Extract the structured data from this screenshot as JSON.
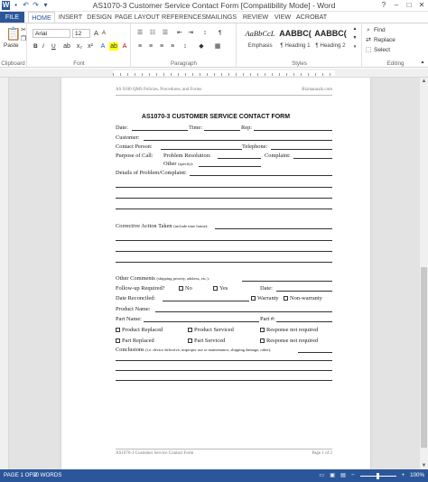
{
  "window": {
    "title": "AS1070-3 Customer Service Contact Form [Compatibility Mode] - Word",
    "controls": {
      "help": "?",
      "minimize": "–",
      "restore": "□",
      "close": "✕"
    }
  },
  "tabs": {
    "file": "FILE",
    "home": "HOME",
    "insert": "INSERT",
    "design": "DESIGN",
    "page_layout": "PAGE LAYOUT",
    "references": "REFERENCES",
    "mailings": "MAILINGS",
    "review": "REVIEW",
    "view": "VIEW",
    "acrobat": "ACROBAT"
  },
  "ribbon": {
    "clipboard": {
      "label": "Clipboard",
      "paste": "Paste"
    },
    "font": {
      "label": "Font",
      "name": "Arial",
      "size": "12",
      "bold": "B",
      "italic": "I",
      "underline": "U",
      "grow": "A",
      "shrink": "A"
    },
    "paragraph": {
      "label": "Paragraph",
      "marks": "¶"
    },
    "styles": {
      "label": "Styles",
      "items": [
        {
          "sample": "AaBbCcL",
          "name": "Emphasis"
        },
        {
          "sample": "AABBC(",
          "name": "¶ Heading 1"
        },
        {
          "sample": "AABBC(",
          "name": "¶ Heading 2"
        }
      ]
    },
    "editing": {
      "label": "Editing",
      "find": "Find",
      "replace": "Replace",
      "select": "Select"
    }
  },
  "document": {
    "header_left": "AS 9100 QMS Policies, Procedures, and Forms",
    "header_right": "Bizmanualz.com",
    "form_title": "AS1070-3 CUSTOMER SERVICE CONTACT FORM",
    "date": "Date:",
    "time": "Time:",
    "rep": "Rep:",
    "customer": "Customer:",
    "contact_person": "Contact Person:",
    "telephone": "Telephone:",
    "purpose": "Purpose of Call:",
    "problem_resolution": "Problem Resolution:",
    "complaint": "Complaint:",
    "other": "Other",
    "specify": "(specify):",
    "details": "Details of Problem/Complaint:",
    "corrective": "Corrective Action Taken",
    "corrective_note": "(include time frame):",
    "other_comments": "Other Comments",
    "other_comments_note": "(shipping priority, address, etc.):",
    "followup": "Follow-up Required?",
    "no": "No",
    "yes": "Yes",
    "date2": "Date:",
    "date_reconciled": "Date Reconciled:",
    "warranty": "Warranty",
    "non_warranty": "Non-warranty",
    "product_name": "Product Name:",
    "part_name": "Part Name:",
    "part_no": "Part #:",
    "product_replaced": "Product Replaced",
    "product_serviced": "Product Serviced",
    "response_not_required_1": "Response not required",
    "part_replaced": "Part Replaced",
    "part_serviced": "Part Serviced",
    "response_not_required_2": "Response not required",
    "conclusions": "Conclusions",
    "conclusions_note": "(i.e. device defective, improper use or maintenance, shipping damage, other):",
    "footer_left": "AS1070-3 Customer Service Contact Form",
    "footer_right": "Page 1 of 2"
  },
  "status": {
    "page": "PAGE 1 OF 2",
    "words": "90 WORDS",
    "zoom": "100%",
    "zoom_minus": "−",
    "zoom_plus": "+"
  }
}
